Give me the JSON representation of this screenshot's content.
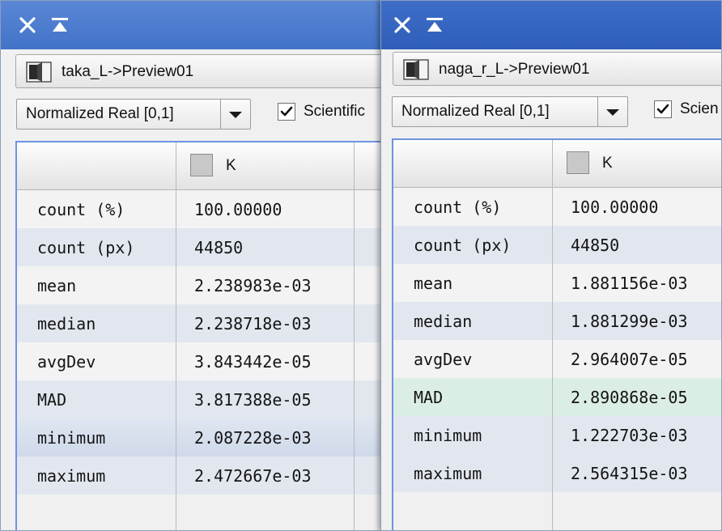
{
  "windows": [
    {
      "id": "left",
      "view_label": "taka_L->Preview01",
      "mode_select": "Normalized Real [0,1]",
      "checkbox_label": "Scientific",
      "checkbox_checked": true,
      "channel_header": "K",
      "rows": [
        {
          "label": "count (%)",
          "value": "100.00000"
        },
        {
          "label": "count (px)",
          "value": "44850"
        },
        {
          "label": "mean",
          "value": "2.238983e-03"
        },
        {
          "label": "median",
          "value": "2.238718e-03"
        },
        {
          "label": "avgDev",
          "value": "3.843442e-05"
        },
        {
          "label": "MAD",
          "value": "3.817388e-05"
        },
        {
          "label": "minimum",
          "value": "2.087228e-03"
        },
        {
          "label": "maximum",
          "value": "2.472667e-03"
        }
      ]
    },
    {
      "id": "right",
      "view_label": "naga_r_L->Preview01",
      "mode_select": "Normalized Real [0,1]",
      "checkbox_label": "Scien",
      "checkbox_checked": true,
      "channel_header": "K",
      "rows": [
        {
          "label": "count (%)",
          "value": "100.00000"
        },
        {
          "label": "count (px)",
          "value": "44850"
        },
        {
          "label": "mean",
          "value": "1.881156e-03"
        },
        {
          "label": "median",
          "value": "1.881299e-03"
        },
        {
          "label": "avgDev",
          "value": "2.964007e-05"
        },
        {
          "label": "MAD",
          "value": "2.890868e-05"
        },
        {
          "label": "minimum",
          "value": "1.222703e-03"
        },
        {
          "label": "maximum",
          "value": "2.564315e-03"
        }
      ]
    }
  ],
  "icons": {
    "close": "close-icon",
    "shade": "shade-icon",
    "view": "view-icon",
    "dropdown": "chevron-down-icon",
    "check": "checkmark-icon"
  },
  "colors": {
    "titlebar": "#2f5eb8",
    "table_border": "#6f93e0",
    "row_alt": "#e2e7ef"
  }
}
